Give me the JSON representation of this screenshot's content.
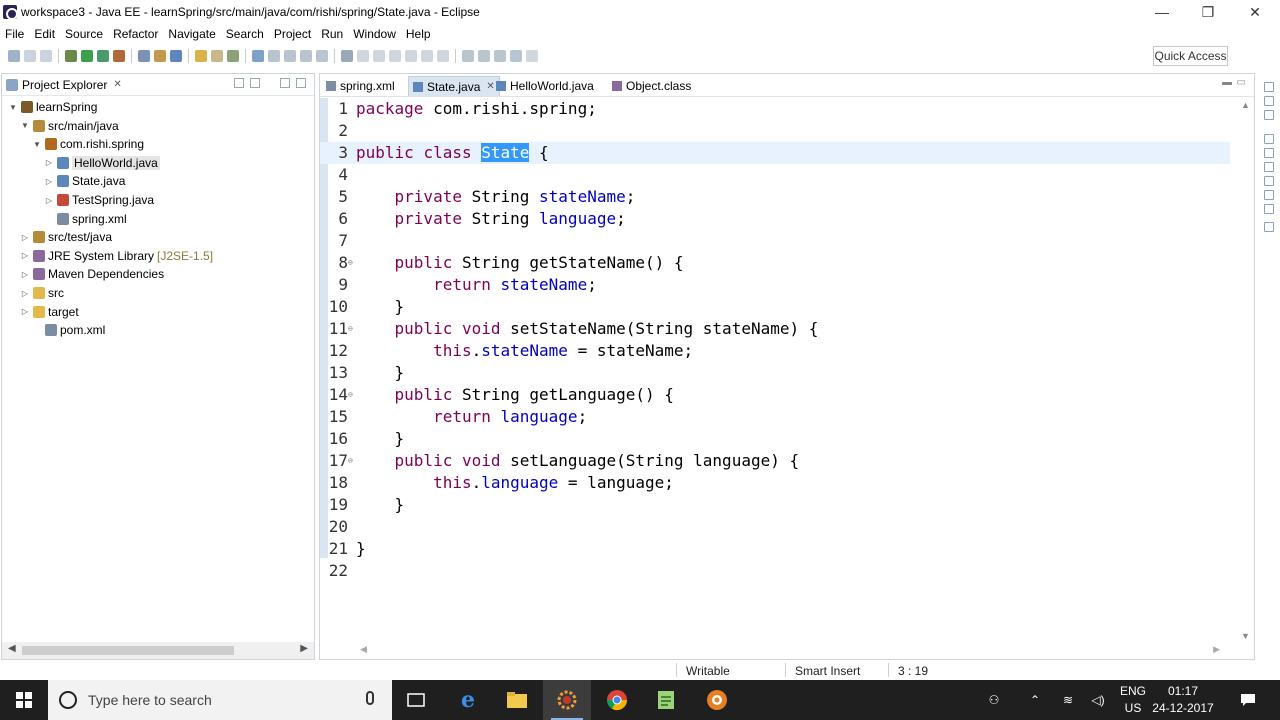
{
  "window": {
    "title": "workspace3 - Java EE - learnSpring/src/main/java/com/rishi/spring/State.java - Eclipse",
    "minimize": "—",
    "restore": "❐",
    "close": "✕"
  },
  "menu": [
    "File",
    "Edit",
    "Source",
    "Refactor",
    "Navigate",
    "Search",
    "Project",
    "Run",
    "Window",
    "Help"
  ],
  "toolbar": {
    "quick_access": "Quick Access"
  },
  "explorer": {
    "title": "Project Explorer",
    "close": "✕",
    "tree": [
      {
        "label": "learnSpring",
        "twisty": "▼",
        "icon": "project-icon",
        "color": "#7b5a2a"
      },
      {
        "label": "src/main/java",
        "twisty": "▼",
        "icon": "source-folder-icon",
        "color": "#b58a3b"
      },
      {
        "label": "com.rishi.spring",
        "twisty": "▼",
        "icon": "package-icon",
        "color": "#b0671e"
      },
      {
        "label": "HelloWorld.java",
        "twisty": "▷",
        "icon": "java-file-icon",
        "color": "#5d87bb",
        "selected": true
      },
      {
        "label": "State.java",
        "twisty": "▷",
        "icon": "java-file-icon",
        "color": "#5d87bb"
      },
      {
        "label": "TestSpring.java",
        "twisty": "▷",
        "icon": "java-file-error-icon",
        "color": "#c54a3a"
      },
      {
        "label": "spring.xml",
        "twisty": "",
        "icon": "xml-file-icon",
        "color": "#7c8da3"
      },
      {
        "label": "src/test/java",
        "twisty": "▷",
        "icon": "source-folder-icon",
        "color": "#b58a3b"
      },
      {
        "label": "JRE System Library",
        "deco": "[J2SE-1.5]",
        "twisty": "▷",
        "icon": "library-icon",
        "color": "#8a6a9a"
      },
      {
        "label": "Maven Dependencies",
        "twisty": "▷",
        "icon": "library-icon",
        "color": "#8a6a9a"
      },
      {
        "label": "src",
        "twisty": "▷",
        "icon": "folder-icon",
        "color": "#e4b94b"
      },
      {
        "label": "target",
        "twisty": "▷",
        "icon": "folder-icon",
        "color": "#e4b94b"
      },
      {
        "label": "pom.xml",
        "twisty": "",
        "icon": "maven-pom-icon",
        "color": "#7c8da3"
      }
    ]
  },
  "editor": {
    "tabs": [
      {
        "label": "spring.xml",
        "active": false
      },
      {
        "label": "State.java",
        "active": true
      },
      {
        "label": "HelloWorld.java",
        "active": false
      },
      {
        "label": "Object.class",
        "active": false
      }
    ],
    "tab_close": "✕",
    "current_line": 3,
    "lines": [
      {
        "n": "1",
        "fold": "",
        "code": [
          {
            "t": "package",
            "c": "kw"
          },
          {
            "t": " com.rishi.spring;",
            "c": ""
          }
        ]
      },
      {
        "n": "2",
        "fold": "",
        "code": []
      },
      {
        "n": "3",
        "fold": "",
        "code": [
          {
            "t": "public",
            "c": "kw"
          },
          {
            "t": " ",
            "c": ""
          },
          {
            "t": "class",
            "c": "kw"
          },
          {
            "t": " ",
            "c": ""
          },
          {
            "t": "State",
            "c": "hl"
          },
          {
            "t": " {",
            "c": ""
          }
        ]
      },
      {
        "n": "4",
        "fold": "",
        "code": []
      },
      {
        "n": "5",
        "fold": "",
        "code": [
          {
            "t": "    ",
            "c": ""
          },
          {
            "t": "private",
            "c": "kw"
          },
          {
            "t": " String ",
            "c": ""
          },
          {
            "t": "stateName",
            "c": "fld"
          },
          {
            "t": ";",
            "c": ""
          }
        ]
      },
      {
        "n": "6",
        "fold": "",
        "code": [
          {
            "t": "    ",
            "c": ""
          },
          {
            "t": "private",
            "c": "kw"
          },
          {
            "t": " String ",
            "c": ""
          },
          {
            "t": "language",
            "c": "fld"
          },
          {
            "t": ";",
            "c": ""
          }
        ]
      },
      {
        "n": "7",
        "fold": "",
        "code": []
      },
      {
        "n": "8",
        "fold": "⊖",
        "code": [
          {
            "t": "    ",
            "c": ""
          },
          {
            "t": "public",
            "c": "kw"
          },
          {
            "t": " String getStateName() {",
            "c": ""
          }
        ]
      },
      {
        "n": "9",
        "fold": "",
        "code": [
          {
            "t": "        ",
            "c": ""
          },
          {
            "t": "return",
            "c": "kw"
          },
          {
            "t": " ",
            "c": ""
          },
          {
            "t": "stateName",
            "c": "fld"
          },
          {
            "t": ";",
            "c": ""
          }
        ]
      },
      {
        "n": "10",
        "fold": "",
        "code": [
          {
            "t": "    }",
            "c": ""
          }
        ]
      },
      {
        "n": "11",
        "fold": "⊖",
        "code": [
          {
            "t": "    ",
            "c": ""
          },
          {
            "t": "public",
            "c": "kw"
          },
          {
            "t": " ",
            "c": ""
          },
          {
            "t": "void",
            "c": "kw"
          },
          {
            "t": " setStateName(String stateName) {",
            "c": ""
          }
        ]
      },
      {
        "n": "12",
        "fold": "",
        "code": [
          {
            "t": "        ",
            "c": ""
          },
          {
            "t": "this",
            "c": "kw"
          },
          {
            "t": ".",
            "c": ""
          },
          {
            "t": "stateName",
            "c": "fld"
          },
          {
            "t": " = stateName;",
            "c": ""
          }
        ]
      },
      {
        "n": "13",
        "fold": "",
        "code": [
          {
            "t": "    }",
            "c": ""
          }
        ]
      },
      {
        "n": "14",
        "fold": "⊖",
        "code": [
          {
            "t": "    ",
            "c": ""
          },
          {
            "t": "public",
            "c": "kw"
          },
          {
            "t": " String getLanguage() {",
            "c": ""
          }
        ]
      },
      {
        "n": "15",
        "fold": "",
        "code": [
          {
            "t": "        ",
            "c": ""
          },
          {
            "t": "return",
            "c": "kw"
          },
          {
            "t": " ",
            "c": ""
          },
          {
            "t": "language",
            "c": "fld"
          },
          {
            "t": ";",
            "c": ""
          }
        ]
      },
      {
        "n": "16",
        "fold": "",
        "code": [
          {
            "t": "    }",
            "c": ""
          }
        ]
      },
      {
        "n": "17",
        "fold": "⊖",
        "code": [
          {
            "t": "    ",
            "c": ""
          },
          {
            "t": "public",
            "c": "kw"
          },
          {
            "t": " ",
            "c": ""
          },
          {
            "t": "void",
            "c": "kw"
          },
          {
            "t": " setLanguage(String language) {",
            "c": ""
          }
        ]
      },
      {
        "n": "18",
        "fold": "",
        "code": [
          {
            "t": "        ",
            "c": ""
          },
          {
            "t": "this",
            "c": "kw"
          },
          {
            "t": ".",
            "c": ""
          },
          {
            "t": "language",
            "c": "fld"
          },
          {
            "t": " = language;",
            "c": ""
          }
        ]
      },
      {
        "n": "19",
        "fold": "",
        "code": [
          {
            "t": "    }",
            "c": ""
          }
        ]
      },
      {
        "n": "20",
        "fold": "",
        "code": []
      },
      {
        "n": "21",
        "fold": "",
        "code": [
          {
            "t": "}",
            "c": ""
          }
        ]
      },
      {
        "n": "22",
        "fold": "",
        "code": []
      }
    ]
  },
  "status": {
    "writable": "Writable",
    "insert_mode": "Smart Insert",
    "position": "3 : 19"
  },
  "taskbar": {
    "search_placeholder": "Type here to search",
    "lang_line1": "ENG",
    "lang_line2": "US",
    "time": "01:17",
    "date": "24-12-2017"
  },
  "colors": {
    "keyword": "#7f0055",
    "field": "#0000c0",
    "selection": "#3399ff",
    "current_line": "#e8f2fe",
    "active_tab": "#dbe5f2"
  }
}
